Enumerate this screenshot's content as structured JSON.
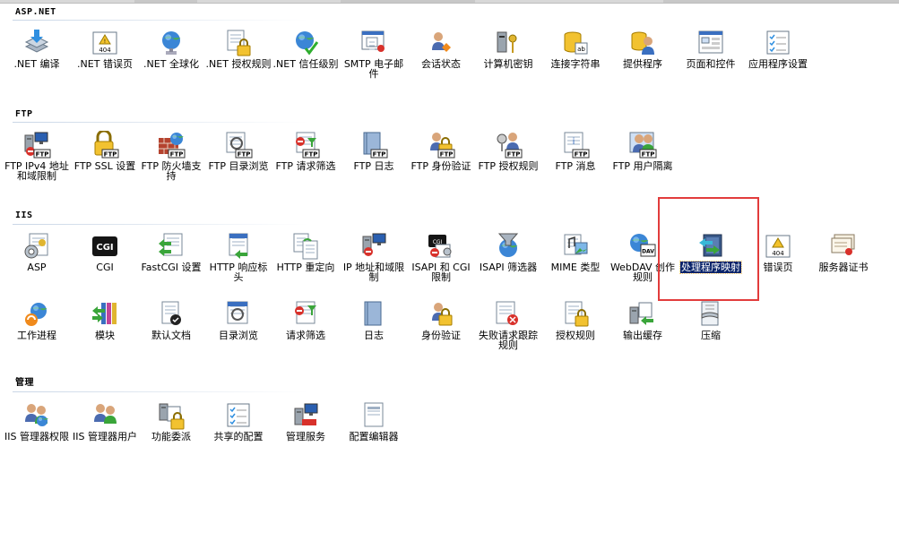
{
  "sections": [
    {
      "key": "aspnet",
      "title": "ASP.NET",
      "items": [
        {
          "label": ".NET 编译",
          "icon": "download-icon"
        },
        {
          "label": ".NET 错误页",
          "icon": "error-404-icon"
        },
        {
          "label": ".NET 全球化",
          "icon": "globe-icon"
        },
        {
          "label": ".NET 授权规则",
          "icon": "authorization-lock-icon"
        },
        {
          "label": ".NET 信任级别",
          "icon": "trust-globe-check-icon"
        },
        {
          "label": "SMTP 电子邮件",
          "icon": "email-icon"
        },
        {
          "label": "会话状态",
          "icon": "session-user-icon"
        },
        {
          "label": "计算机密钥",
          "icon": "machine-key-icon"
        },
        {
          "label": "连接字符串",
          "icon": "connection-string-icon"
        },
        {
          "label": "提供程序",
          "icon": "providers-icon"
        },
        {
          "label": "页面和控件",
          "icon": "pages-controls-icon"
        },
        {
          "label": "应用程序设置",
          "icon": "app-settings-icon"
        }
      ]
    },
    {
      "key": "ftp",
      "title": "FTP",
      "items": [
        {
          "label": "FTP IPv4 地址和域限制",
          "icon": "ftp-ip-restriction-icon"
        },
        {
          "label": "FTP SSL 设置",
          "icon": "ftp-ssl-lock-icon"
        },
        {
          "label": "FTP 防火墙支持",
          "icon": "ftp-firewall-icon"
        },
        {
          "label": "FTP 目录浏览",
          "icon": "ftp-directory-browse-icon"
        },
        {
          "label": "FTP 请求筛选",
          "icon": "ftp-request-filter-icon"
        },
        {
          "label": "FTP 日志",
          "icon": "ftp-log-icon"
        },
        {
          "label": "FTP 身份验证",
          "icon": "ftp-authentication-icon"
        },
        {
          "label": "FTP 授权规则",
          "icon": "ftp-authorization-key-icon"
        },
        {
          "label": "FTP 消息",
          "icon": "ftp-messages-icon"
        },
        {
          "label": "FTP 用户隔离",
          "icon": "ftp-user-isolation-icon"
        }
      ]
    },
    {
      "key": "iis",
      "title": "IIS",
      "items": [
        {
          "label": "ASP",
          "icon": "asp-gear-icon"
        },
        {
          "label": "CGI",
          "icon": "cgi-icon"
        },
        {
          "label": "FastCGI 设置",
          "icon": "fastcgi-icon"
        },
        {
          "label": "HTTP 响应标头",
          "icon": "http-headers-icon"
        },
        {
          "label": "HTTP 重定向",
          "icon": "http-redirect-icon"
        },
        {
          "label": "IP 地址和域限制",
          "icon": "ip-restriction-icon"
        },
        {
          "label": "ISAPI 和 CGI 限制",
          "icon": "isapi-cgi-restriction-icon"
        },
        {
          "label": "ISAPI 筛选器",
          "icon": "isapi-filter-icon"
        },
        {
          "label": "MIME 类型",
          "icon": "mime-types-icon"
        },
        {
          "label": "WebDAV 创作规则",
          "icon": "webdav-icon"
        },
        {
          "label": "处理程序映射",
          "icon": "handler-mappings-icon"
        },
        {
          "label": "错误页",
          "icon": "error-page-404-icon"
        },
        {
          "label": "服务器证书",
          "icon": "server-certificate-icon"
        },
        {
          "label": "工作进程",
          "icon": "worker-process-icon"
        },
        {
          "label": "模块",
          "icon": "modules-icon"
        },
        {
          "label": "默认文档",
          "icon": "default-document-icon"
        },
        {
          "label": "目录浏览",
          "icon": "directory-browse-icon"
        },
        {
          "label": "请求筛选",
          "icon": "request-filter-icon"
        },
        {
          "label": "日志",
          "icon": "logging-icon"
        },
        {
          "label": "身份验证",
          "icon": "authentication-lock-icon"
        },
        {
          "label": "失败请求跟踪规则",
          "icon": "failed-request-tracing-icon"
        },
        {
          "label": "授权规则",
          "icon": "authorization-rules-icon"
        },
        {
          "label": "输出缓存",
          "icon": "output-cache-icon"
        },
        {
          "label": "压缩",
          "icon": "compression-icon"
        }
      ]
    },
    {
      "key": "management",
      "title": "管理",
      "items": [
        {
          "label": "IIS 管理器权限",
          "icon": "manager-permissions-icon"
        },
        {
          "label": "IIS 管理器用户",
          "icon": "manager-users-icon"
        },
        {
          "label": "功能委派",
          "icon": "feature-delegation-icon"
        },
        {
          "label": "共享的配置",
          "icon": "shared-config-icon"
        },
        {
          "label": "管理服务",
          "icon": "management-service-icon"
        },
        {
          "label": "配置编辑器",
          "icon": "config-editor-icon"
        }
      ]
    }
  ],
  "selected_item": "处理程序映射",
  "colors": {
    "selection_bg": "#0a246a",
    "highlight_border": "#e23c3c",
    "header_line": "#c9d6e6"
  }
}
